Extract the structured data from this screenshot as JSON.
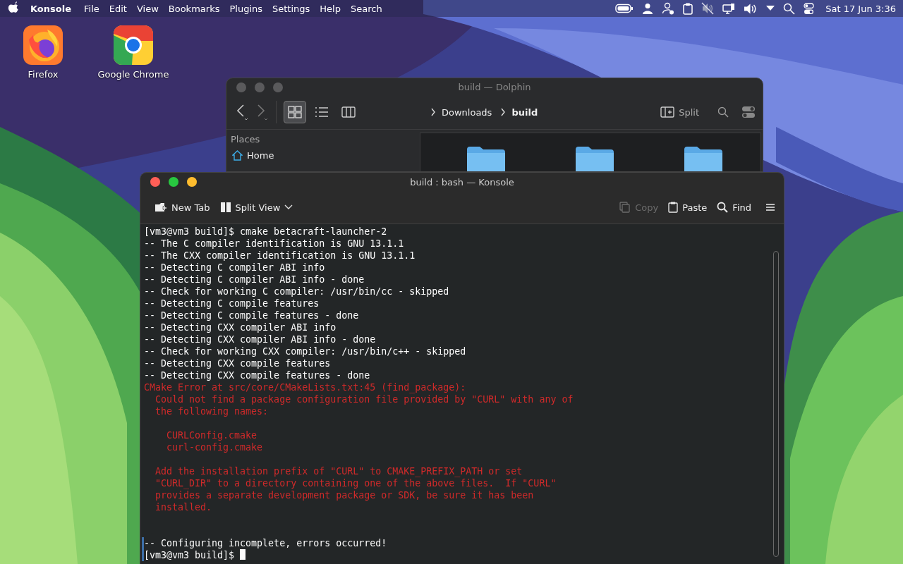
{
  "menu_bar": {
    "app_name": "Konsole",
    "menus": [
      "File",
      "Edit",
      "View",
      "Bookmarks",
      "Plugins",
      "Settings",
      "Help",
      "Search"
    ],
    "clock": "Sat 17 Jun 3:36"
  },
  "desktop_icons": [
    {
      "label": "Firefox",
      "kind": "firefox"
    },
    {
      "label": "Google Chrome",
      "kind": "chrome"
    }
  ],
  "dolphin": {
    "title": "build — Dolphin",
    "view_modes": [
      {
        "kind": "icons",
        "selected": true
      },
      {
        "kind": "details",
        "selected": false
      },
      {
        "kind": "columns",
        "selected": false
      }
    ],
    "breadcrumb": [
      {
        "label": "Downloads",
        "current": false
      },
      {
        "label": "build",
        "current": true
      }
    ],
    "split_label": "Split",
    "places_heading": "Places",
    "places": [
      {
        "label": "Home",
        "kind": "home"
      }
    ]
  },
  "konsole": {
    "title": "build : bash — Konsole",
    "toolbar_left": [
      {
        "label": "New Tab",
        "kind": "new-tab",
        "disabled": false
      },
      {
        "label": "Split View",
        "kind": "split",
        "disabled": false
      }
    ],
    "toolbar_right": [
      {
        "label": "Copy",
        "kind": "copy",
        "disabled": true
      },
      {
        "label": "Paste",
        "kind": "paste",
        "disabled": false
      },
      {
        "label": "Find",
        "kind": "find",
        "disabled": false
      }
    ],
    "lines": [
      {
        "text": "[vm3@vm3 build]$ cmake betacraft-launcher-2",
        "kind": "output"
      },
      {
        "text": "-- The C compiler identification is GNU 13.1.1",
        "kind": "output"
      },
      {
        "text": "-- The CXX compiler identification is GNU 13.1.1",
        "kind": "output"
      },
      {
        "text": "-- Detecting C compiler ABI info",
        "kind": "output"
      },
      {
        "text": "-- Detecting C compiler ABI info - done",
        "kind": "output"
      },
      {
        "text": "-- Check for working C compiler: /usr/bin/cc - skipped",
        "kind": "output"
      },
      {
        "text": "-- Detecting C compile features",
        "kind": "output"
      },
      {
        "text": "-- Detecting C compile features - done",
        "kind": "output"
      },
      {
        "text": "-- Detecting CXX compiler ABI info",
        "kind": "output"
      },
      {
        "text": "-- Detecting CXX compiler ABI info - done",
        "kind": "output"
      },
      {
        "text": "-- Check for working CXX compiler: /usr/bin/c++ - skipped",
        "kind": "output"
      },
      {
        "text": "-- Detecting CXX compile features",
        "kind": "output"
      },
      {
        "text": "-- Detecting CXX compile features - done",
        "kind": "output"
      },
      {
        "text": "CMake Error at src/core/CMakeLists.txt:45 (find_package):",
        "kind": "error"
      },
      {
        "text": "  Could not find a package configuration file provided by \"CURL\" with any of",
        "kind": "error"
      },
      {
        "text": "  the following names:",
        "kind": "error"
      },
      {
        "kind": "blank"
      },
      {
        "text": "    CURLConfig.cmake",
        "kind": "error"
      },
      {
        "text": "    curl-config.cmake",
        "kind": "error"
      },
      {
        "kind": "blank"
      },
      {
        "text": "  Add the installation prefix of \"CURL\" to CMAKE_PREFIX_PATH or set",
        "kind": "error"
      },
      {
        "text": "  \"CURL_DIR\" to a directory containing one of the above files.  If \"CURL\"",
        "kind": "error"
      },
      {
        "text": "  provides a separate development package or SDK, be sure it has been",
        "kind": "error"
      },
      {
        "text": "  installed.",
        "kind": "error"
      },
      {
        "kind": "blank"
      },
      {
        "kind": "blank"
      },
      {
        "text": "-- Configuring incomplete, errors occurred!",
        "kind": "output"
      },
      {
        "text": "[vm3@vm3 build]$ ",
        "kind": "prompt"
      }
    ]
  }
}
